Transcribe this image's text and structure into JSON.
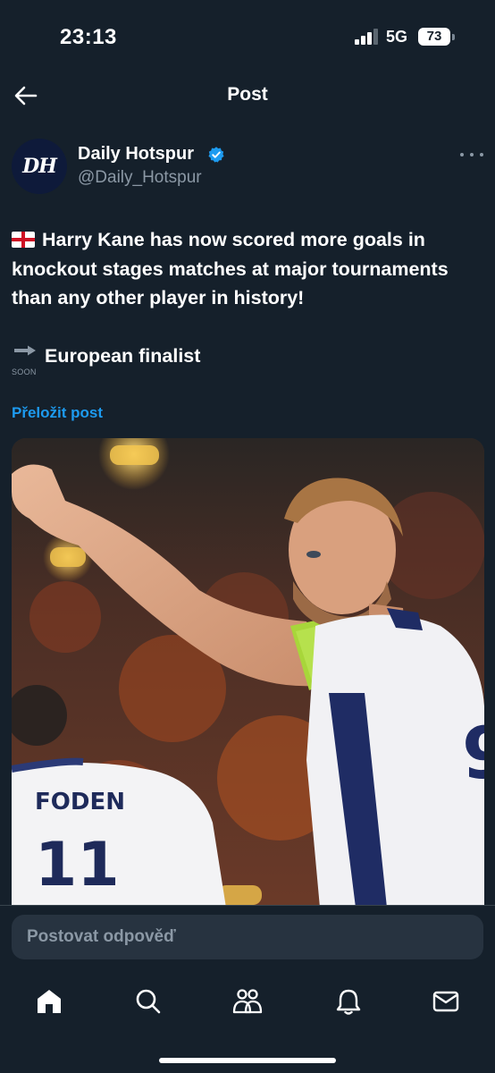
{
  "status_bar": {
    "time": "23:13",
    "network": "5G",
    "battery": "73"
  },
  "header": {
    "title": "Post"
  },
  "author": {
    "avatar_text": "DH",
    "name": "Daily Hotspur",
    "handle": "@Daily_Hotspur"
  },
  "post": {
    "text": "Harry Kane has now scored more goals in knockout stages matches at major tournaments than any other player in history!",
    "soon_label": "SOON",
    "text2": "European finalist",
    "translate_label": "Přeložit post"
  },
  "media": {
    "jersey_name": "FODEN",
    "jersey_number": "11",
    "kane_number": "9"
  },
  "reply": {
    "placeholder": "Postovat odpověď"
  },
  "bottom_nav": {
    "icons": [
      "home-icon",
      "search-icon",
      "communities-icon",
      "notifications-icon",
      "messages-icon"
    ]
  },
  "colors": {
    "background": "#15202b",
    "accent": "#1d9bf0",
    "muted": "#8b98a5"
  }
}
